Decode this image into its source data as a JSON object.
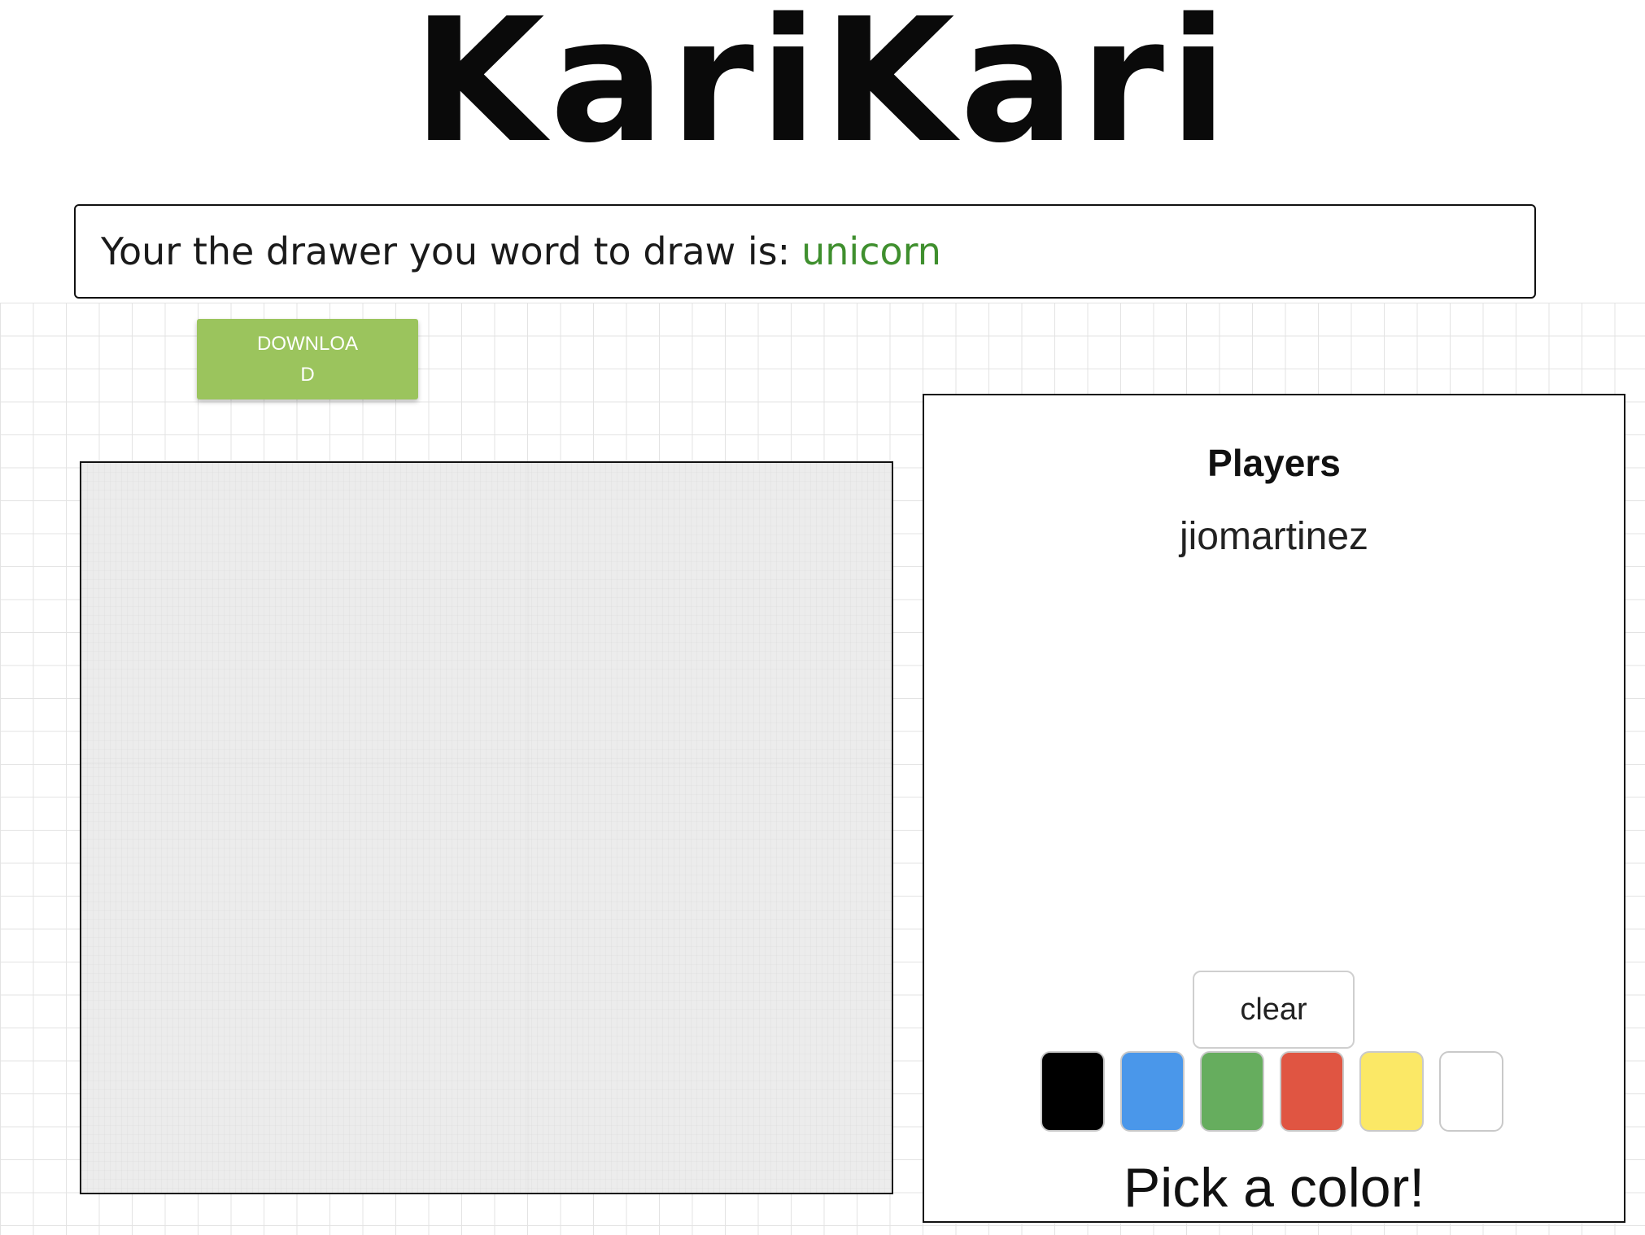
{
  "app": {
    "logo_text": "KariKari"
  },
  "banner": {
    "prompt_text": "Your the drawer you word to draw is:",
    "word": "unicorn",
    "word_color": "#3f8f2e"
  },
  "toolbar": {
    "download_label": "DOWNLOAD",
    "download_color": "#9bc45d"
  },
  "canvas": {
    "name": "drawing canvas"
  },
  "players_panel": {
    "title": "Players",
    "players": [
      "jiomartinez"
    ],
    "clear_label": "clear",
    "colors": [
      {
        "name": "black",
        "hex": "#000000"
      },
      {
        "name": "blue",
        "hex": "#4a97ea"
      },
      {
        "name": "green",
        "hex": "#66ad5e"
      },
      {
        "name": "red",
        "hex": "#e05542"
      },
      {
        "name": "yellow",
        "hex": "#fbe866"
      },
      {
        "name": "white",
        "hex": "#ffffff"
      }
    ],
    "pick_label": "Pick a color!"
  }
}
